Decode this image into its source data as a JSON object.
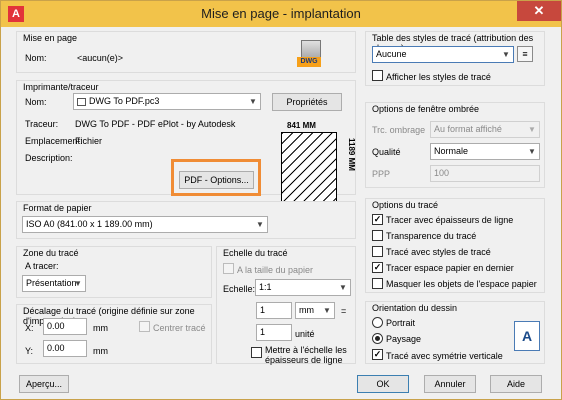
{
  "window": {
    "title": "Mise en page - implantation",
    "close_glyph": "✕",
    "app_icon_letter": "A"
  },
  "page_setup": {
    "group_title": "Mise en page",
    "name_label": "Nom:",
    "name_value": "<aucun(e)>",
    "dwg_badge": "DWG"
  },
  "printer": {
    "group_title": "Imprimante/traceur",
    "name_label": "Nom:",
    "name_value": "DWG To PDF.pc3",
    "properties_button": "Propriétés",
    "plotter_label": "Traceur:",
    "plotter_value": "DWG To PDF - PDF ePlot - by Autodesk",
    "location_label": "Emplacement:",
    "location_value": "Fichier",
    "description_label": "Description:",
    "pdf_options_button": "PDF - Options...",
    "preview_width": "841 MM",
    "preview_height": "1189 MM"
  },
  "paper_size": {
    "group_title": "Format de papier",
    "value": "ISO A0 (841.00 x 1 189.00 mm)"
  },
  "plot_area": {
    "group_title": "Zone du tracé",
    "what_label": "A tracer:",
    "what_value": "Présentation"
  },
  "plot_offset": {
    "group_title": "Décalage du tracé (origine définie sur zone d'impression)",
    "x_label": "X:",
    "x_value": "0.00",
    "x_unit": "mm",
    "y_label": "Y:",
    "y_value": "0.00",
    "y_unit": "mm",
    "center_label": "Centrer tracé"
  },
  "plot_scale": {
    "group_title": "Echelle du tracé",
    "fit_label": "A la taille du papier",
    "scale_label": "Echelle:",
    "scale_value": "1:1",
    "value1": "1",
    "unit1": "mm",
    "equals": "=",
    "value2": "1",
    "unit2": "unité",
    "lineweights_label": "Mettre à l'échelle les épaisseurs de ligne"
  },
  "plot_style_table": {
    "group_title": "Table des styles de tracé (attribution des plumes)",
    "value": "Aucune",
    "display_label": "Afficher les styles de tracé"
  },
  "shaded_viewport": {
    "group_title": "Options de fenêtre ombrée",
    "shade_label": "Trc. ombrage",
    "shade_value": "Au format affiché",
    "quality_label": "Qualité",
    "quality_value": "Normale",
    "dpi_label": "PPP",
    "dpi_value": "100"
  },
  "plot_options": {
    "group_title": "Options du tracé",
    "items": [
      {
        "label": "Tracer avec épaisseurs de ligne",
        "checked": true
      },
      {
        "label": "Transparence du tracé",
        "checked": false
      },
      {
        "label": "Tracé avec styles de tracé",
        "checked": false
      },
      {
        "label": "Tracer espace papier en dernier",
        "checked": true
      },
      {
        "label": "Masquer les objets de l'espace papier",
        "checked": false
      }
    ]
  },
  "orientation": {
    "group_title": "Orientation du dessin",
    "portrait": "Portrait",
    "landscape": "Paysage",
    "upside_down": "Tracé avec symétrie verticale",
    "icon_letter": "A"
  },
  "footer": {
    "preview_button": "Aperçu...",
    "ok_button": "OK",
    "cancel_button": "Annuler",
    "help_button": "Aide"
  },
  "check_glyph": "✓",
  "dropdown_glyph": "▼",
  "accent_color": "#f08c35"
}
